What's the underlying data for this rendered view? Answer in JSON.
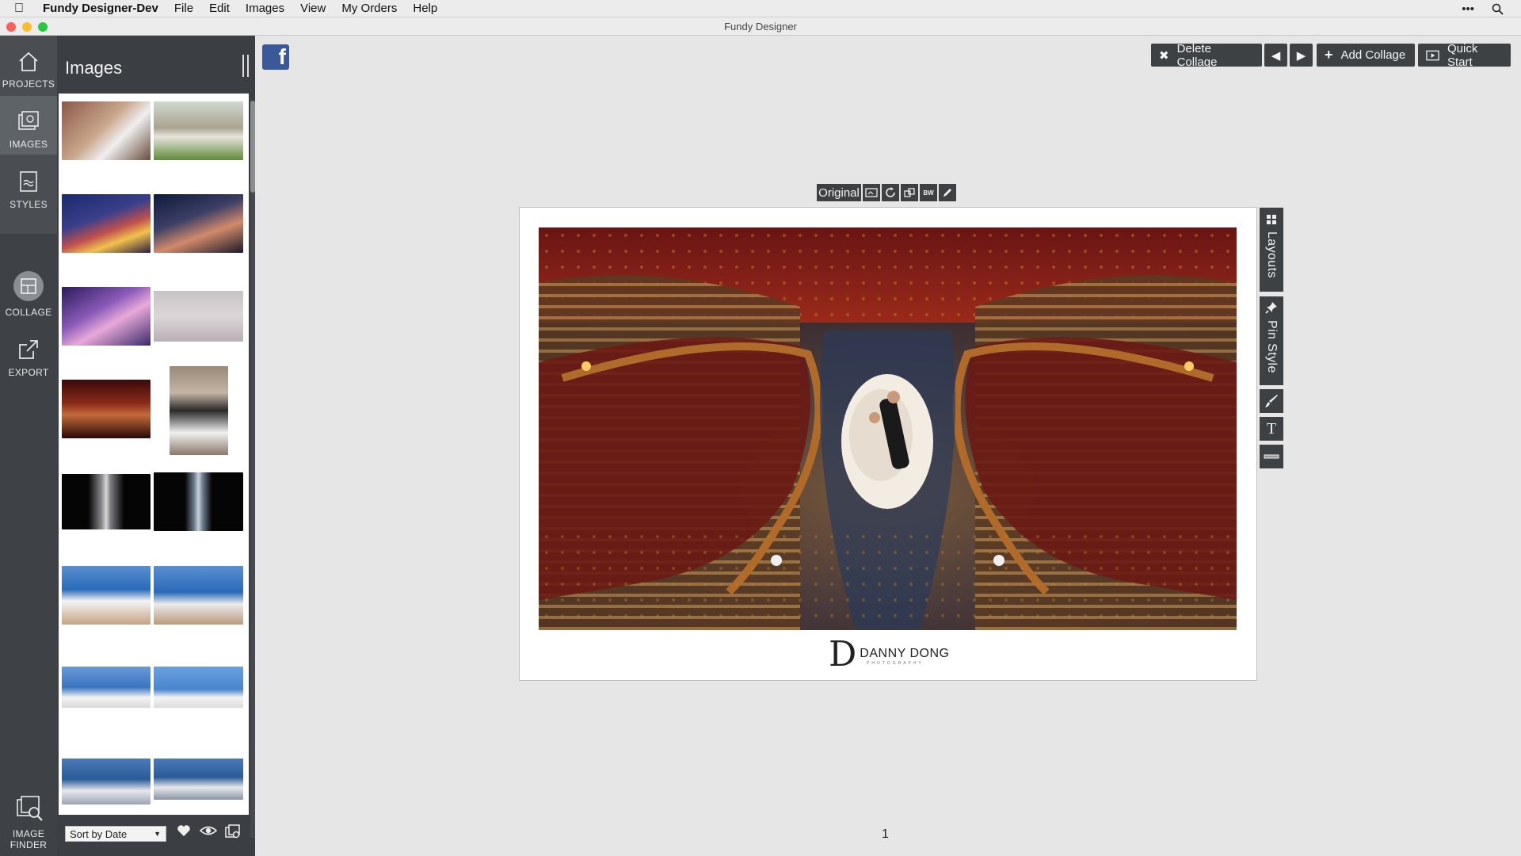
{
  "menubar": {
    "app_name": "Fundy Designer-Dev",
    "items": [
      "File",
      "Edit",
      "Images",
      "View",
      "My Orders",
      "Help"
    ]
  },
  "window": {
    "title": "Fundy Designer"
  },
  "rail": {
    "items": [
      {
        "label": "PROJECTS",
        "icon": "home-icon"
      },
      {
        "label": "IMAGES",
        "icon": "images-icon"
      },
      {
        "label": "STYLES",
        "icon": "styles-icon"
      },
      {
        "label": "COLLAGE",
        "icon": "collage-icon"
      },
      {
        "label": "EXPORT",
        "icon": "export-icon"
      }
    ],
    "finder_label_1": "IMAGE",
    "finder_label_2": "FINDER"
  },
  "panel": {
    "title": "Images",
    "sort": {
      "selected": "Sort by Date"
    }
  },
  "toolbar": {
    "delete_label": "Delete Collage",
    "add_label": "Add Collage",
    "quickstart_label": "Quick Start"
  },
  "image_tools": {
    "original_label": "Original",
    "bw_label": "BW"
  },
  "side_tools": {
    "layouts_label": "Layouts",
    "pinstyle_label": "Pin Style",
    "text_label": "T"
  },
  "logo": {
    "name": "DANNY DONG",
    "sub": "PHOTOGRAPHY"
  },
  "page_number": "1",
  "colors": {
    "rail": "#4a4e52",
    "panel": "#3b3e42",
    "button": "#3d4144",
    "facebook": "#3b5998"
  }
}
